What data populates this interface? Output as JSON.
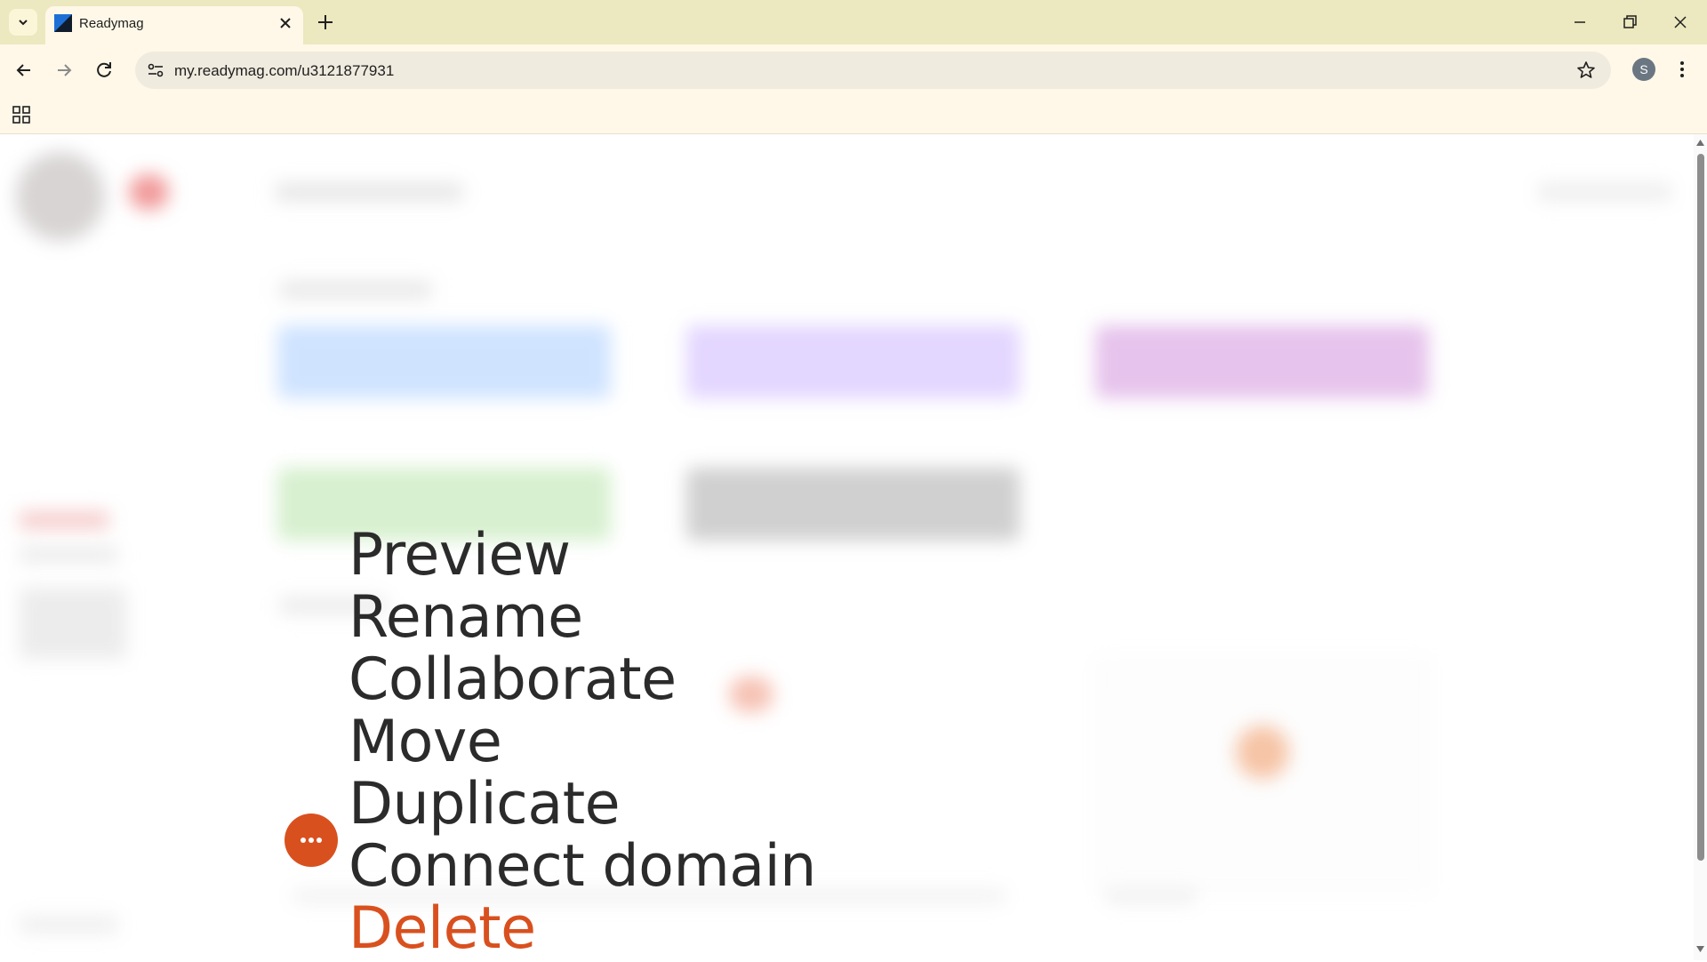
{
  "browser": {
    "tab_title": "Readymag",
    "url": "my.readymag.com/u3121877931",
    "profile_initial": "S"
  },
  "context_menu": {
    "items": [
      "Preview",
      "Rename",
      "Collaborate",
      "Move",
      "Duplicate",
      "Connect domain",
      "Delete"
    ],
    "danger_color": "#d9501f"
  },
  "colors": {
    "accent": "#d9501f",
    "tab_bar": "#ece8bf",
    "toolbar": "#fff8e8"
  },
  "icons": {
    "tab_list": "chevron-down-icon",
    "favicon": "readymag-logo-icon",
    "close": "close-icon",
    "new_tab": "plus-icon",
    "back": "back-arrow-icon",
    "forward": "forward-arrow-icon",
    "reload": "reload-icon",
    "site_info": "site-info-icon",
    "bookmark": "star-icon",
    "menu": "kebab-menu-icon",
    "apps": "apps-grid-icon",
    "more": "ellipsis-icon"
  }
}
